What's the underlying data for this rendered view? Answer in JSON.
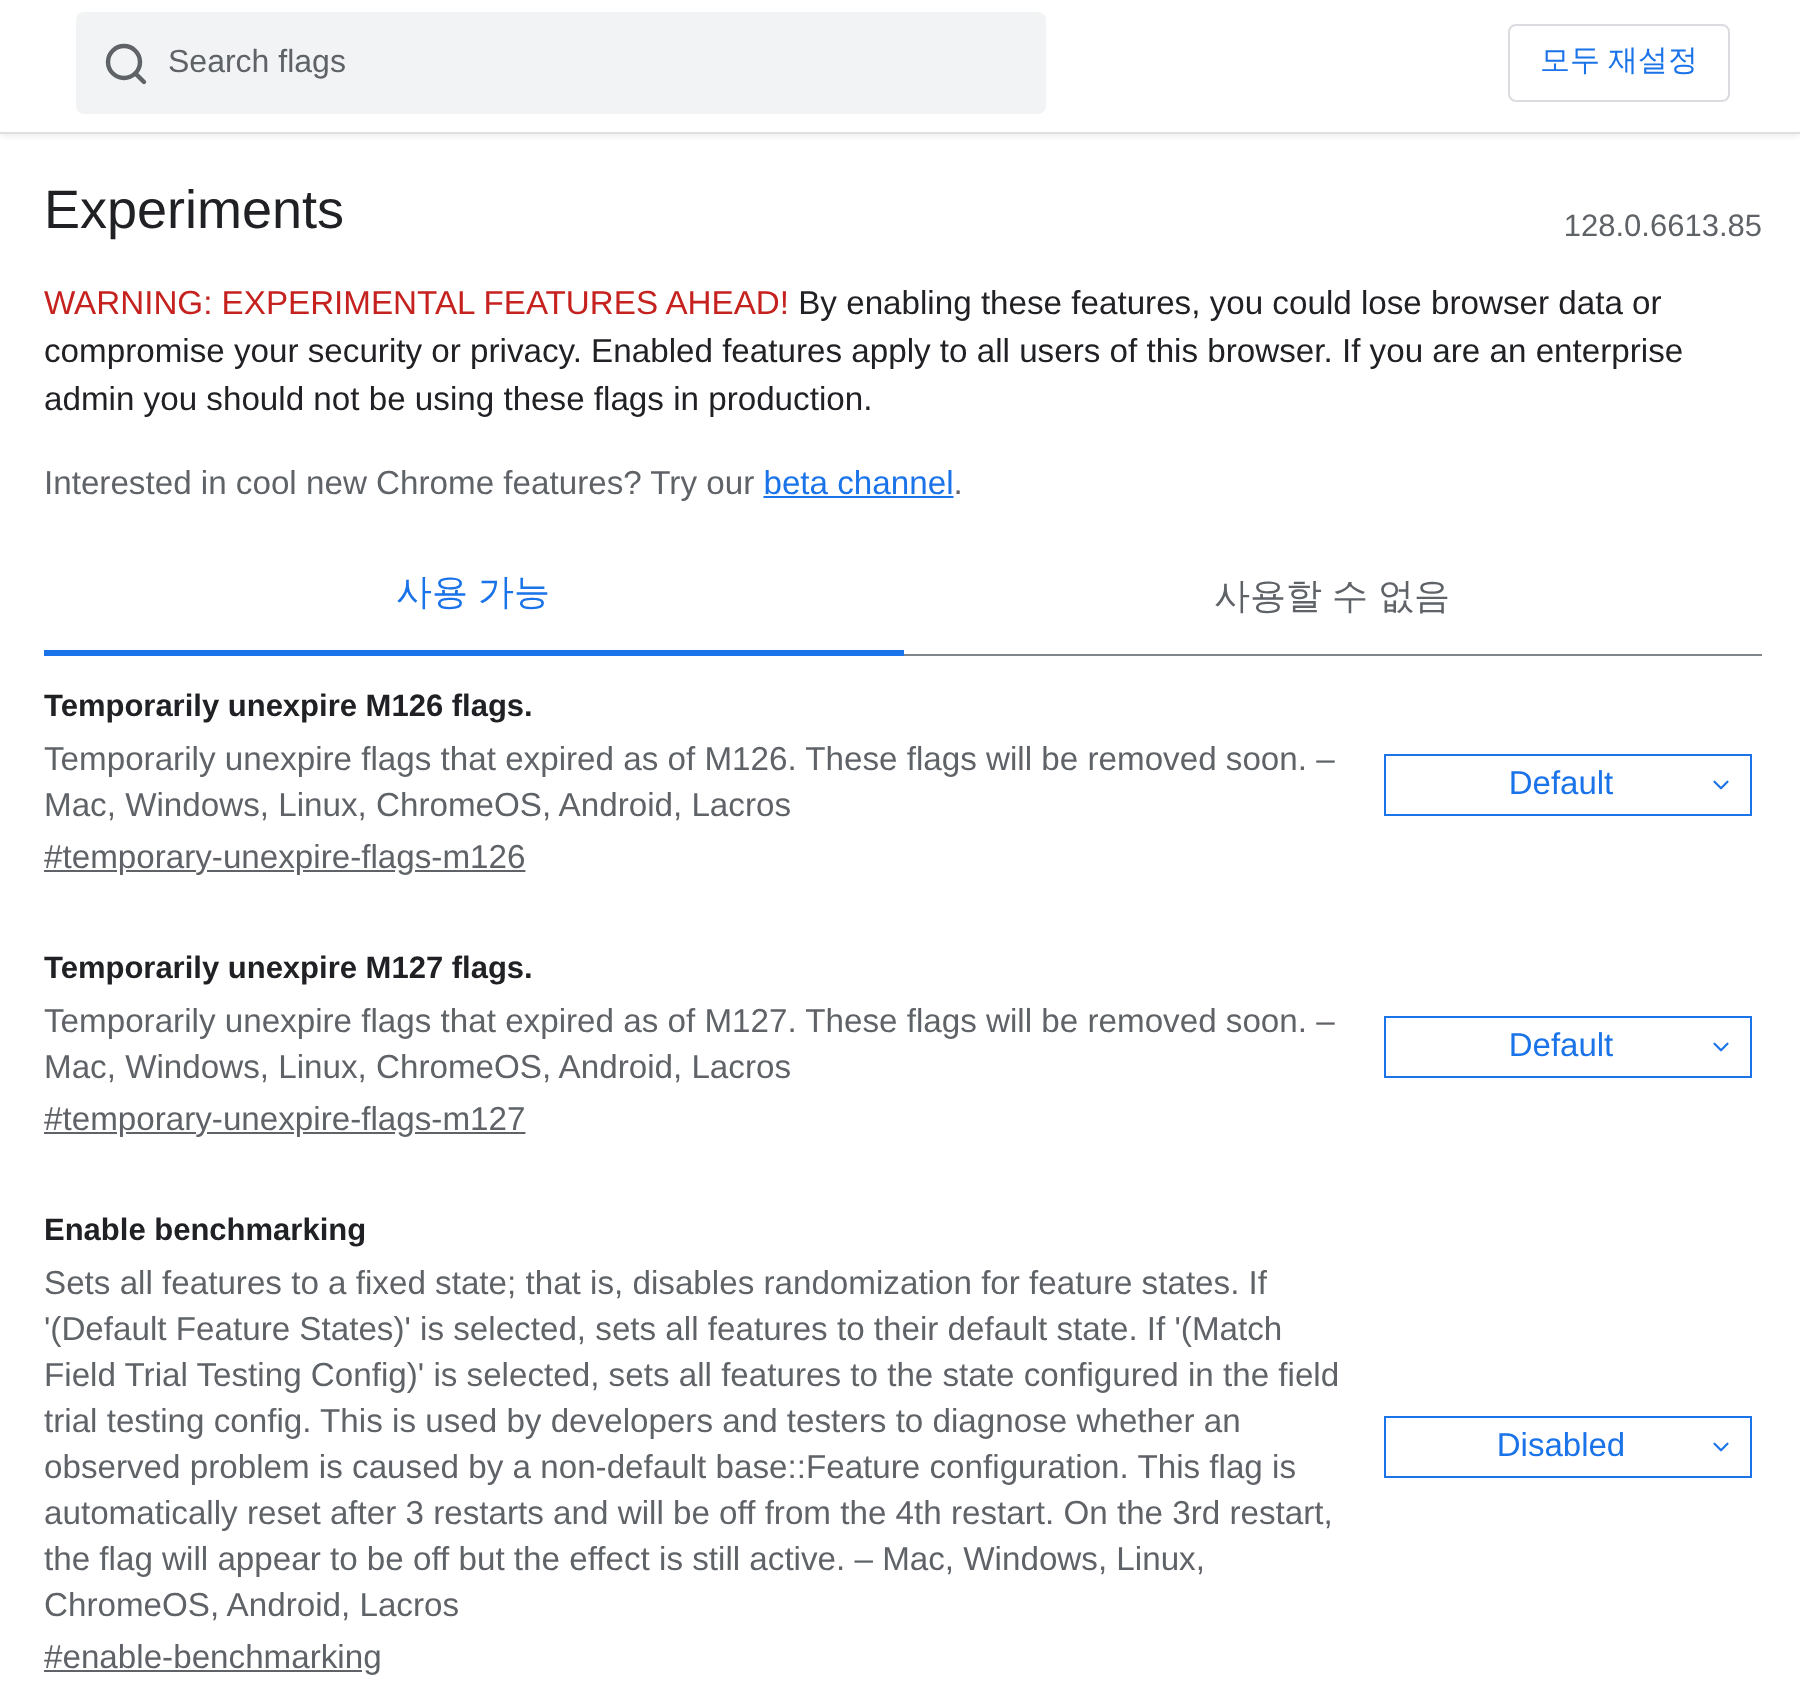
{
  "header": {
    "search": {
      "placeholder": "Search flags"
    },
    "reset_button": "모두 재설정"
  },
  "title": "Experiments",
  "version": "128.0.6613.85",
  "warning": {
    "lead": "WARNING: EXPERIMENTAL FEATURES AHEAD!",
    "text": " By enabling these features, you could lose browser data or compromise your security or privacy. Enabled features apply to all users of this browser. If you are an enterprise admin you should not be using these flags in production."
  },
  "intro": {
    "text": "Interested in cool new Chrome features? Try our ",
    "link": "beta channel",
    "after": "."
  },
  "tabs": [
    {
      "label": "사용 가능",
      "selected": true
    },
    {
      "label": "사용할 수 없음",
      "selected": false
    }
  ],
  "flags": [
    {
      "title": "Temporarily unexpire M126 flags.",
      "description": "Temporarily unexpire flags that expired as of M126. These flags will be removed soon. – Mac, Windows, Linux, ChromeOS, Android, Lacros",
      "anchor": "#temporary-unexpire-flags-m126",
      "value": "Default"
    },
    {
      "title": "Temporarily unexpire M127 flags.",
      "description": "Temporarily unexpire flags that expired as of M127. These flags will be removed soon. – Mac, Windows, Linux, ChromeOS, Android, Lacros",
      "anchor": "#temporary-unexpire-flags-m127",
      "value": "Default"
    },
    {
      "title": "Enable benchmarking",
      "description": "Sets all features to a fixed state; that is, disables randomization for feature states. If '(Default Feature States)' is selected, sets all features to their default state. If '(Match Field Trial Testing Config)' is selected, sets all features to the state configured in the field trial testing config. This is used by developers and testers to diagnose whether an observed problem is caused by a non-default base::Feature configuration. This flag is automatically reset after 3 restarts and will be off from the 4th restart. On the 3rd restart, the flag will appear to be off but the effect is still active. – Mac, Windows, Linux, ChromeOS, Android, Lacros",
      "anchor": "#enable-benchmarking",
      "value": "Disabled"
    }
  ]
}
